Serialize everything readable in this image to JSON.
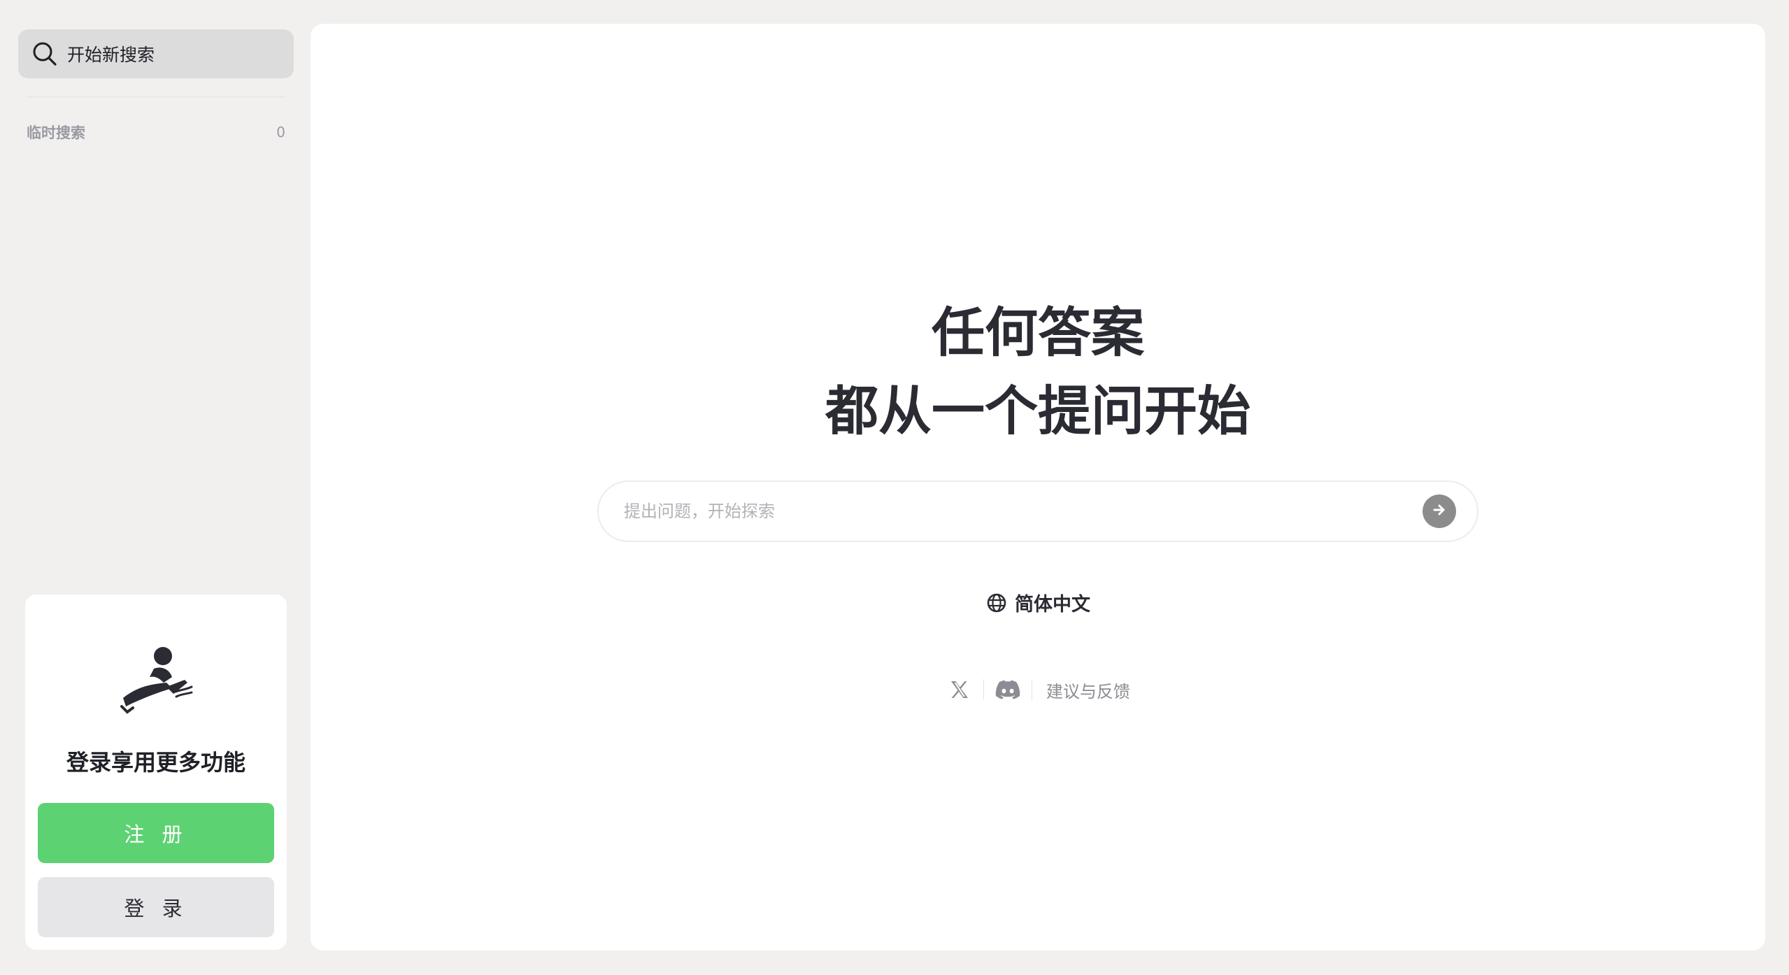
{
  "sidebar": {
    "new_search_label": "开始新搜索",
    "temp_section": {
      "title": "临时搜索",
      "count": "0"
    },
    "login_card": {
      "title": "登录享用更多功能",
      "register_label": "注 册",
      "login_label": "登 录"
    }
  },
  "main": {
    "headline_line1": "任何答案",
    "headline_line2": "都从一个提问开始",
    "ask_placeholder": "提出问题，开始探索",
    "language_label": "简体中文",
    "feedback_label": "建议与反馈"
  },
  "icons": {
    "search": "search-icon",
    "send": "arrow-right-icon",
    "globe": "globe-icon",
    "x": "x-logo-icon",
    "discord": "discord-icon",
    "illustration": "reading-person-illustration"
  },
  "colors": {
    "page_bg": "#f1f0ee",
    "register_green": "#5dd273",
    "login_gray": "#e6e6e8",
    "send_button": "#8c8c8c"
  }
}
